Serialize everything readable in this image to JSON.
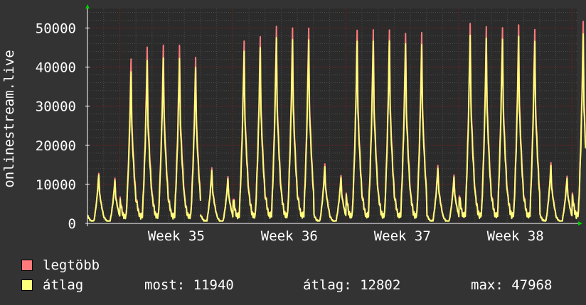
{
  "chart_data": {
    "type": "line",
    "ylabel": "onlinestream.live",
    "ylim": [
      0,
      55000
    ],
    "y_ticks": [
      {
        "value": 0,
        "label": "0"
      },
      {
        "value": 10000,
        "label": "10000"
      },
      {
        "value": 20000,
        "label": "20000"
      },
      {
        "value": 30000,
        "label": "30000"
      },
      {
        "value": 40000,
        "label": "40000"
      },
      {
        "value": 50000,
        "label": "50000"
      }
    ],
    "x_ticks": [
      {
        "day": 5.5,
        "label": "Week 35"
      },
      {
        "day": 12.5,
        "label": "Week 36"
      },
      {
        "day": 19.5,
        "label": "Week 37"
      },
      {
        "day": 26.5,
        "label": "Week 38"
      }
    ],
    "x_range_days": [
      0,
      30.3
    ],
    "days": [
      {
        "day": 0,
        "avg_peak": 12500,
        "max_peak": 12900
      },
      {
        "day": 1,
        "avg_peak": 11000,
        "max_peak": 11500
      },
      {
        "day": 2,
        "avg_peak": 39000,
        "max_peak": 42300
      },
      {
        "day": 3,
        "avg_peak": 41500,
        "max_peak": 44900
      },
      {
        "day": 4,
        "avg_peak": 42500,
        "max_peak": 45800
      },
      {
        "day": 5,
        "avg_peak": 42000,
        "max_peak": 45400
      },
      {
        "day": 6,
        "avg_peak": 40000,
        "max_peak": 42600,
        "gap_after": true
      },
      {
        "day": 7,
        "avg_peak": 13500,
        "max_peak": 14200
      },
      {
        "day": 8,
        "avg_peak": 11500,
        "max_peak": 12000
      },
      {
        "day": 9,
        "avg_peak": 44000,
        "max_peak": 46600
      },
      {
        "day": 10,
        "avg_peak": 45000,
        "max_peak": 47800
      },
      {
        "day": 11,
        "avg_peak": 47500,
        "max_peak": 50400
      },
      {
        "day": 12,
        "avg_peak": 47000,
        "max_peak": 50000
      },
      {
        "day": 13,
        "avg_peak": 47000,
        "max_peak": 50000
      },
      {
        "day": 14,
        "avg_peak": 14500,
        "max_peak": 15200
      },
      {
        "day": 15,
        "avg_peak": 11800,
        "max_peak": 12300
      },
      {
        "day": 16,
        "avg_peak": 46500,
        "max_peak": 49300
      },
      {
        "day": 17,
        "avg_peak": 46800,
        "max_peak": 49700
      },
      {
        "day": 18,
        "avg_peak": 46500,
        "max_peak": 49300
      },
      {
        "day": 19,
        "avg_peak": 46200,
        "max_peak": 48800
      },
      {
        "day": 20,
        "avg_peak": 45500,
        "max_peak": 48600
      },
      {
        "day": 21,
        "avg_peak": 14200,
        "max_peak": 14900
      },
      {
        "day": 22,
        "avg_peak": 11800,
        "max_peak": 12300
      },
      {
        "day": 23,
        "avg_peak": 48500,
        "max_peak": 51500
      },
      {
        "day": 24,
        "avg_peak": 47000,
        "max_peak": 50000
      },
      {
        "day": 25,
        "avg_peak": 47500,
        "max_peak": 50400
      },
      {
        "day": 26,
        "avg_peak": 47500,
        "max_peak": 50400
      },
      {
        "day": 27,
        "avg_peak": 47000,
        "max_peak": 50000
      },
      {
        "day": 28,
        "avg_peak": 14700,
        "max_peak": 15400
      },
      {
        "day": 29,
        "avg_peak": 11700,
        "max_peak": 12200
      },
      {
        "day": 30,
        "avg_peak": 47968,
        "max_peak": 51200,
        "end": true
      }
    ],
    "series": [
      {
        "name": "legtöbb",
        "color": "#ff7b7b"
      },
      {
        "name": "átlag",
        "color": "#ffff7b"
      }
    ],
    "grid": true,
    "legend_position": "bottom-left"
  },
  "legend": {
    "max_label": "legtöbb",
    "avg_label": "átlag",
    "max_color": "#ff7b7b",
    "avg_color": "#ffff7b"
  },
  "stats": {
    "current": "most: 11940",
    "average": "átlag: 12802",
    "max": "max: 47968"
  },
  "colors": {
    "background": "#333333",
    "plot_background": "#2b2b2b",
    "grid_minor": "#4a4a4a",
    "grid_major": "#7a2020",
    "axis": "#ffffff",
    "arrow": "#00cc00"
  }
}
